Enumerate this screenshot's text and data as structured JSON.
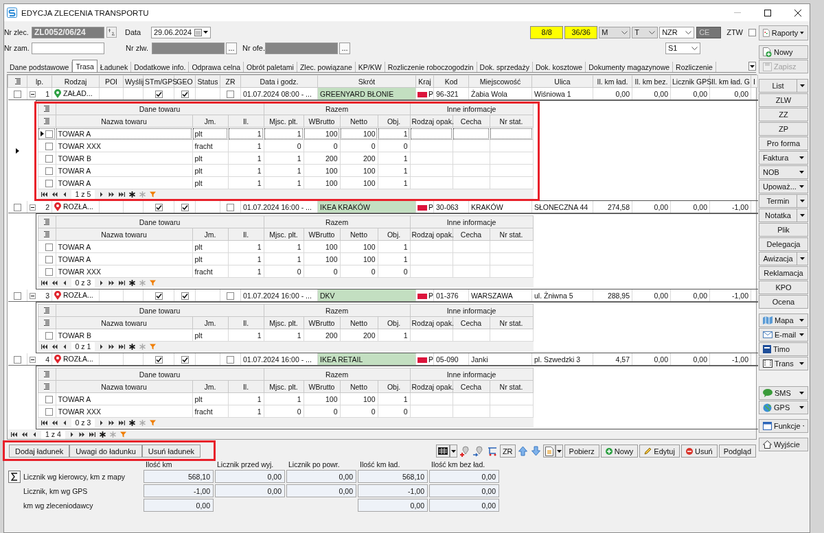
{
  "window": {
    "title": "EDYCJA ZLECENIA TRANSPORTU"
  },
  "header": {
    "order_label": "Nr zlec.",
    "order_no": "ZL0052/06/24",
    "date_label": "Data",
    "date": "29.06.2024",
    "customer_order_label": "Nr zam.",
    "zlw_label": "Nr zlw.",
    "zlw_browse": "...",
    "offer_label": "Nr ofe.",
    "offer_browse": "...",
    "counters": [
      "8/8",
      "36/36"
    ],
    "combos": [
      {
        "value": "M",
        "disabled": true
      },
      {
        "value": "T",
        "disabled": true
      },
      {
        "value": "NZR",
        "disabled": false
      }
    ],
    "ce": "CE",
    "ztw": {
      "label": "ZTW",
      "checked": false
    },
    "s1": "S1"
  },
  "tabs": [
    {
      "label": "Dane podstawowe",
      "selected": false
    },
    {
      "label": "Trasa",
      "selected": true
    },
    {
      "label": "Ładunek",
      "selected": false
    },
    {
      "label": "Dodatkowe info.",
      "selected": false
    },
    {
      "label": "Odprawa celna",
      "selected": false
    },
    {
      "label": "Obrót paletami",
      "selected": false
    },
    {
      "label": "Zlec. powiązane",
      "selected": false
    },
    {
      "label": "KP/KW",
      "selected": false
    },
    {
      "label": "Rozliczenie roboczogodzin",
      "selected": false
    },
    {
      "label": "Dok. sprzedaży",
      "selected": false
    },
    {
      "label": "Dok. kosztowe",
      "selected": false
    },
    {
      "label": "Dokumenty magazynowe",
      "selected": false
    },
    {
      "label": "Rozliczenie",
      "selected": false
    }
  ],
  "grid": {
    "columns": [
      "lp.",
      "Rodzaj",
      "POI",
      "Wyślij",
      "STm/GPS",
      "GEO",
      "Status",
      "ZR",
      "Data i godz.",
      "Skrót",
      "Kraj",
      "Kod",
      "Miejscowość",
      "Ulica",
      "Il. km ład.",
      "Il. km bez.",
      "Licznik GPS",
      "Il. km ład. G",
      "I"
    ],
    "rows": [
      {
        "lp": "1",
        "type": "ZAŁAD...",
        "color": "#2ea043",
        "checked": false,
        "expanded": true,
        "current": true,
        "stm_gps": true,
        "geo": true,
        "zr": false,
        "datetime": "01.07.2024 08:00 - ...",
        "short_name": "GREENYARD BŁONIE",
        "country": "P",
        "postcode": "96-321",
        "city": "Żabia Wola",
        "street": "Wiśniowa 1",
        "km_loaded": "0,00",
        "km_empty": "0,00",
        "gps_counter": "0,00",
        "km_loaded_gps": "0,00",
        "detail": {
          "groups": [
            "Dane towaru",
            "Razem",
            "Inne informacje"
          ],
          "columns": [
            "Nazwa towaru",
            "Jm.",
            "Il.",
            "Mjsc. plt.",
            "WBrutto",
            "Netto",
            "Obj.",
            "Rodzaj opak.",
            "Cecha",
            "Nr stat."
          ],
          "pager": "1 z 5",
          "items": [
            {
              "name": "TOWAR A",
              "unit": "plt",
              "qty": "1",
              "pallets": "1",
              "gross": "100",
              "net": "100",
              "volume": "1",
              "checked": false,
              "current": true
            },
            {
              "name": "TOWAR XXX",
              "unit": "fracht",
              "qty": "1",
              "pallets": "0",
              "gross": "0",
              "net": "0",
              "volume": "0",
              "checked": false,
              "current": false
            },
            {
              "name": "TOWAR B",
              "unit": "plt",
              "qty": "1",
              "pallets": "1",
              "gross": "200",
              "net": "200",
              "volume": "1",
              "checked": false,
              "current": false
            },
            {
              "name": "TOWAR A",
              "unit": "plt",
              "qty": "1",
              "pallets": "1",
              "gross": "100",
              "net": "100",
              "volume": "1",
              "checked": false,
              "current": false
            },
            {
              "name": "TOWAR A",
              "unit": "plt",
              "qty": "1",
              "pallets": "1",
              "gross": "100",
              "net": "100",
              "volume": "1",
              "checked": false,
              "current": false
            }
          ]
        }
      },
      {
        "lp": "2",
        "type": "ROZŁA...",
        "color": "#e0242c",
        "checked": false,
        "expanded": true,
        "current": false,
        "stm_gps": true,
        "geo": true,
        "zr": false,
        "datetime": "01.07.2024 16:00 - ...",
        "short_name": "IKEA KRAKÓW",
        "country": "P",
        "postcode": "30-063",
        "city": "KRAKÓW",
        "street": "SŁONECZNA 44",
        "km_loaded": "274,58",
        "km_empty": "0,00",
        "gps_counter": "0,00",
        "km_loaded_gps": "-1,00",
        "detail": {
          "groups": [
            "Dane towaru",
            "Razem",
            "Inne informacje"
          ],
          "columns": [
            "Nazwa towaru",
            "Jm.",
            "Il.",
            "Mjsc. plt.",
            "WBrutto",
            "Netto",
            "Obj.",
            "Rodzaj opak.",
            "Cecha",
            "Nr stat."
          ],
          "pager": "0 z 3",
          "items": [
            {
              "name": "TOWAR A",
              "unit": "plt",
              "qty": "1",
              "pallets": "1",
              "gross": "100",
              "net": "100",
              "volume": "1",
              "checked": false,
              "current": false
            },
            {
              "name": "TOWAR A",
              "unit": "plt",
              "qty": "1",
              "pallets": "1",
              "gross": "100",
              "net": "100",
              "volume": "1",
              "checked": false,
              "current": false
            },
            {
              "name": "TOWAR XXX",
              "unit": "fracht",
              "qty": "1",
              "pallets": "0",
              "gross": "0",
              "net": "0",
              "volume": "0",
              "checked": false,
              "current": false
            }
          ]
        }
      },
      {
        "lp": "3",
        "type": "ROZŁA...",
        "color": "#e0242c",
        "checked": false,
        "expanded": true,
        "current": false,
        "stm_gps": true,
        "geo": true,
        "zr": false,
        "datetime": "01.07.2024 16:00 - ...",
        "short_name": "DKV",
        "country": "P",
        "postcode": "01-376",
        "city": "WARSZAWA",
        "street": "ul. Żniwna 5",
        "km_loaded": "288,95",
        "km_empty": "0,00",
        "gps_counter": "0,00",
        "km_loaded_gps": "-1,00",
        "detail": {
          "groups": [
            "Dane towaru",
            "Razem",
            "Inne informacje"
          ],
          "columns": [
            "Nazwa towaru",
            "Jm.",
            "Il.",
            "Mjsc. plt.",
            "WBrutto",
            "Netto",
            "Obj.",
            "Rodzaj opak.",
            "Cecha",
            "Nr stat."
          ],
          "pager": "0 z 1",
          "items": [
            {
              "name": "TOWAR B",
              "unit": "plt",
              "qty": "1",
              "pallets": "1",
              "gross": "200",
              "net": "200",
              "volume": "1",
              "checked": false,
              "current": false
            }
          ]
        }
      },
      {
        "lp": "4",
        "type": "ROZŁA...",
        "color": "#e0242c",
        "checked": false,
        "expanded": true,
        "current": false,
        "stm_gps": true,
        "geo": true,
        "zr": false,
        "datetime": "01.07.2024 16:00 - ...",
        "short_name": "IKEA RETAIL",
        "country": "P",
        "postcode": "05-090",
        "city": "Janki",
        "street": "pl. Szwedzki 3",
        "km_loaded": "4,57",
        "km_empty": "0,00",
        "gps_counter": "0,00",
        "km_loaded_gps": "-1,00",
        "detail": {
          "groups": [
            "Dane towaru",
            "Razem",
            "Inne informacje"
          ],
          "columns": [
            "Nazwa towaru",
            "Jm.",
            "Il.",
            "Mjsc. plt.",
            "WBrutto",
            "Netto",
            "Obj.",
            "Rodzaj opak.",
            "Cecha",
            "Nr stat."
          ],
          "pager": "0 z 3",
          "items": [
            {
              "name": "TOWAR A",
              "unit": "plt",
              "qty": "1",
              "pallets": "1",
              "gross": "100",
              "net": "100",
              "volume": "1",
              "checked": false,
              "current": false
            },
            {
              "name": "TOWAR XXX",
              "unit": "fracht",
              "qty": "1",
              "pallets": "0",
              "gross": "0",
              "net": "0",
              "volume": "0",
              "checked": false,
              "current": false
            }
          ]
        }
      }
    ],
    "pager": "1 z 4"
  },
  "cargo_buttons": [
    "Dodaj ładunek",
    "Uwagi do ładunku",
    "Usuń ładunek"
  ],
  "toolbar": {
    "zr": "ZR",
    "buttons": [
      "Pobierz",
      "Nowy",
      "Edytuj",
      "Usuń",
      "Podgląd"
    ]
  },
  "summary": {
    "columns": [
      "Ilość km",
      "Licznik przed wyj.",
      "Licznik po powr.",
      "Ilość km ład.",
      "Ilość km bez ład."
    ],
    "rows": [
      {
        "label": "Licznik wg kierowcy, km z mapy",
        "cells": [
          {
            "kind": "field",
            "text": "568,10"
          },
          {
            "kind": "field",
            "text": "0,00"
          },
          {
            "kind": "field",
            "text": "0,00"
          },
          {
            "kind": "field",
            "text": "568,10"
          },
          {
            "kind": "field",
            "text": "0,00"
          }
        ]
      },
      {
        "label": "Licznik, km  wg GPS",
        "cells": [
          {
            "kind": "field",
            "text": "-1,00"
          },
          {
            "kind": "field",
            "text": "0,00"
          },
          {
            "kind": "field",
            "text": "0,00"
          },
          {
            "kind": "field",
            "text": "-1,00"
          },
          {
            "kind": "field",
            "text": "0,00"
          }
        ]
      },
      {
        "label": "km wg zleceniodawcy",
        "cells": [
          {
            "kind": "field",
            "text": "0,00"
          },
          {
            "kind": "blank"
          },
          {
            "kind": "blank"
          },
          {
            "kind": "field",
            "text": "0,00"
          },
          {
            "kind": "field",
            "text": "0,00"
          }
        ]
      }
    ]
  },
  "side": {
    "reports": "Raporty",
    "record_buttons": [
      {
        "label": "Nowy",
        "disabled": false
      },
      {
        "label": "Zapisz",
        "disabled": true
      }
    ],
    "groups": [
      [
        {
          "label": "List",
          "kind": "split"
        },
        {
          "label": "ZLW",
          "kind": "plain"
        },
        {
          "label": "ZZ",
          "kind": "plain"
        },
        {
          "label": "ZP",
          "kind": "plain"
        },
        {
          "label": "Pro forma",
          "kind": "plain"
        },
        {
          "label": "Faktura",
          "kind": "menu"
        },
        {
          "label": "NOB",
          "kind": "menu"
        },
        {
          "label": "Upoważ...",
          "kind": "menu"
        },
        {
          "label": "Termin",
          "kind": "split"
        },
        {
          "label": "Notatka",
          "kind": "split"
        },
        {
          "label": "Plik",
          "kind": "plain"
        },
        {
          "label": "Delegacja",
          "kind": "plain"
        },
        {
          "label": "Awizacja",
          "kind": "split"
        },
        {
          "label": "Reklamacja",
          "kind": "plain"
        },
        {
          "label": "KPO",
          "kind": "plain"
        },
        {
          "label": "Ocena",
          "kind": "plain"
        }
      ],
      [
        {
          "label": "Mapa",
          "kind": "menu"
        },
        {
          "label": "E-mail",
          "kind": "menu"
        },
        {
          "label": "Timo",
          "kind": "plain"
        },
        {
          "label": "Trans",
          "kind": "menu"
        }
      ],
      [
        {
          "label": "SMS",
          "kind": "menu"
        },
        {
          "label": "GPS",
          "kind": "menu"
        }
      ],
      [
        {
          "label": "Funkcje",
          "kind": "menu"
        }
      ],
      [
        {
          "label": "Wyjście",
          "kind": "plain"
        }
      ]
    ]
  }
}
